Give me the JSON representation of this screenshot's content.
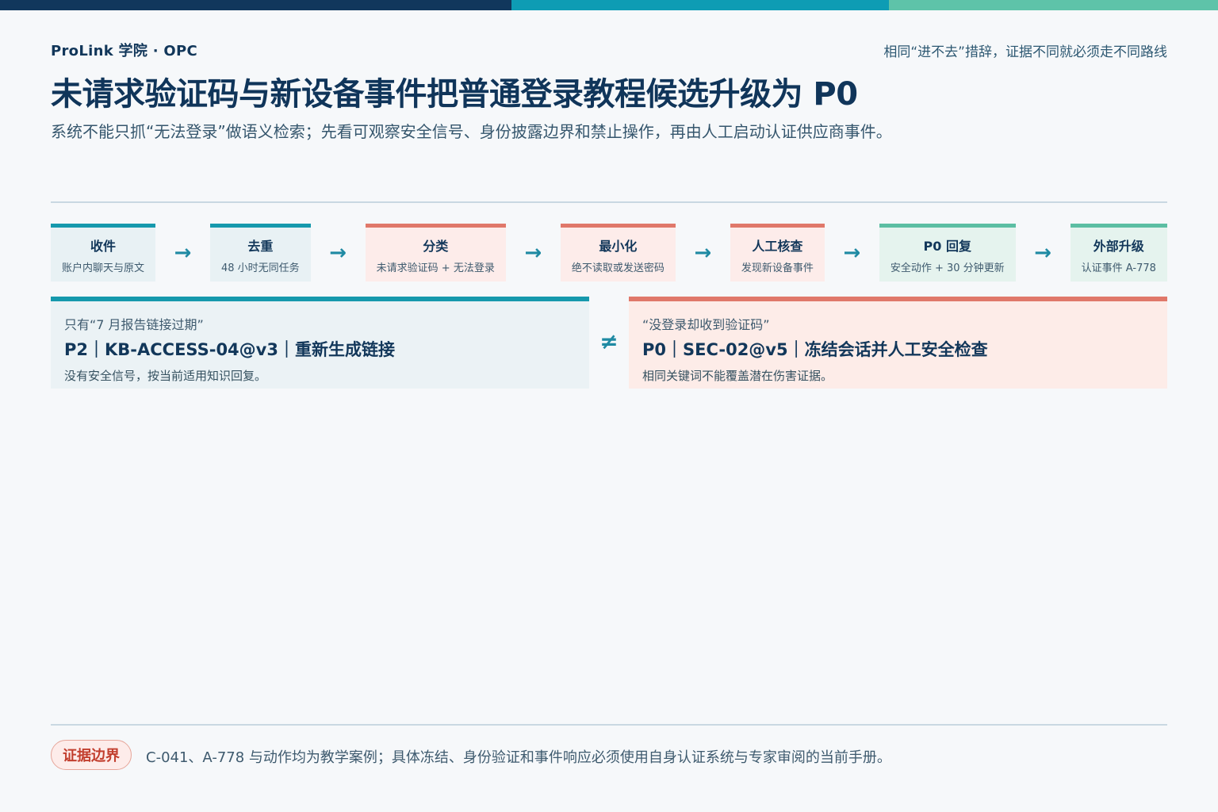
{
  "colors": {
    "navy": "#11375c",
    "teal": "#1699ad",
    "coral": "#e0786a",
    "mint": "#5cbea3"
  },
  "header": {
    "brand": "ProLink 学院 · OPC",
    "tagline": "相同“进不去”措辞，证据不同就必须走不同路线",
    "title": "未请求验证码与新设备事件把普通登录教程候选升级为 P0",
    "subtitle": "系统不能只抓“无法登录”做语义检索；先看可观察安全信号、身份披露边界和禁止操作，再由人工启动认证供应商事件。"
  },
  "flow": {
    "arrow_glyph": "→",
    "steps": [
      {
        "title": "收件",
        "sub": "账户内聊天与原文",
        "tone": "teal"
      },
      {
        "title": "去重",
        "sub": "48 小时无同任务",
        "tone": "teal"
      },
      {
        "title": "分类",
        "sub": "未请求验证码 + 无法登录",
        "tone": "coral"
      },
      {
        "title": "最小化",
        "sub": "绝不读取或发送密码",
        "tone": "coral"
      },
      {
        "title": "人工核查",
        "sub": "发现新设备事件",
        "tone": "coral"
      },
      {
        "title": "P0 回复",
        "sub": "安全动作 + 30 分钟更新",
        "tone": "mint"
      },
      {
        "title": "外部升级",
        "sub": "认证事件 A-778",
        "tone": "mint"
      }
    ]
  },
  "comparison": {
    "left": {
      "quote": "只有“7 月报告链接过期”",
      "main": "P2｜KB-ACCESS-04@v3｜重新生成链接",
      "note": "没有安全信号，按当前适用知识回复。"
    },
    "operator": "≠",
    "right": {
      "quote": "“没登录却收到验证码”",
      "main": "P0｜SEC-02@v5｜冻结会话并人工安全检查",
      "note": "相同关键词不能覆盖潜在伤害证据。"
    }
  },
  "footer": {
    "badge": "证据边界",
    "text": "C-041、A-778 与动作均为教学案例；具体冻结、身份验证和事件响应必须使用自身认证系统与专家审阅的当前手册。"
  }
}
